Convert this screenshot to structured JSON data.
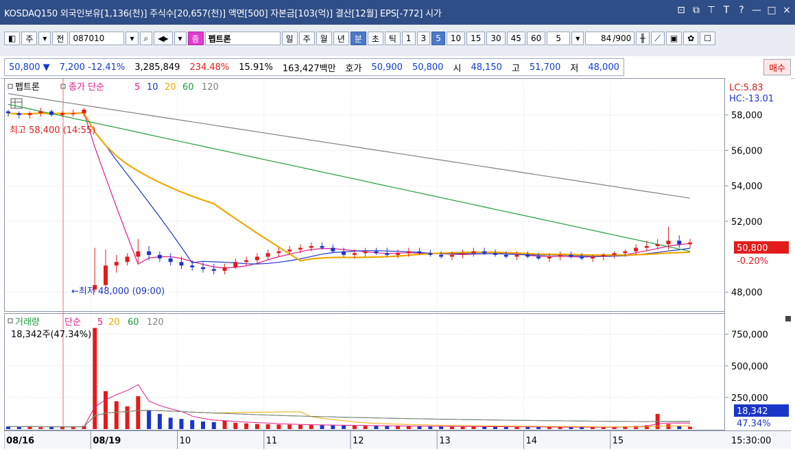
{
  "title_bar": {
    "text": "KOSDAQ150 외국인보유[1,136(천)] 주식수[20,657(천)] 액면[500] 자본금[103(억)] 결산[12월] EPS[-772] 시가"
  },
  "toolbar": {
    "mode_jusik": "주",
    "mode_jeon": "전",
    "code": "087010",
    "stock_badge": "종",
    "stock_name": "펩트론",
    "periods": [
      "일",
      "주",
      "월",
      "년",
      "분",
      "초",
      "틱"
    ],
    "minutes": [
      "1",
      "3",
      "5",
      "10",
      "15",
      "30",
      "45",
      "60"
    ],
    "active_minute": "5",
    "period_select": "5",
    "count_value": "84",
    "count_total": "/900"
  },
  "quote": {
    "price": "50,800",
    "change": "7,200",
    "change_pct": "-12.41%",
    "volume": "3,285,849",
    "vol_ratio": "234.48%",
    "turnover": "15.91%",
    "amount": "163,427백만",
    "hoga_label": "호가",
    "ask": "50,900",
    "bid": "50,800",
    "open_label": "시",
    "open": "48,150",
    "high_label": "고",
    "high": "51,700",
    "low_label": "저",
    "low": "48,000",
    "buy_btn": "매수"
  },
  "price_panel": {
    "name": "펩트론",
    "legend_prefix": "종가 단순",
    "ma_labels": [
      "5",
      "10",
      "20",
      "60",
      "120"
    ],
    "ma_colors": [
      "#e0198a",
      "#1a35c8",
      "#f0a800",
      "#1f9a3a",
      "#808080"
    ],
    "high_note": "최고 58,400 (14:55)",
    "low_note": "←최저 48,000 (09:00)",
    "lc": "LC:5.83",
    "hc": "HC:-13.01",
    "last_price": "50,800",
    "last_pct": "-0.20%",
    "y_ticks": [
      "58,000",
      "56,000",
      "54,000",
      "52,000",
      "48,000"
    ]
  },
  "volume_panel": {
    "name": "거래량",
    "legend_prefix": "단순",
    "ma_labels": [
      "5",
      "20",
      "60",
      "120"
    ],
    "ma_colors": [
      "#e0198a",
      "#f0a800",
      "#1f9a3a",
      "#808080"
    ],
    "current": "18,342주(47.34%)",
    "y_ticks": [
      "750,000",
      "500,000",
      "250,000"
    ],
    "last_vol": "18,342",
    "last_pct": "47.34%"
  },
  "x_axis": {
    "labels": [
      "08/16",
      "08/19",
      "10",
      "11",
      "12",
      "13",
      "14",
      "15"
    ],
    "time": "15:30:00"
  },
  "chart_data": {
    "type": "candlestick",
    "price_ylim": [
      47000,
      60000
    ],
    "candles": [
      [
        58200,
        58300,
        57900,
        58100
      ],
      [
        58100,
        58200,
        57800,
        58000
      ],
      [
        58000,
        58200,
        57800,
        58100
      ],
      [
        58100,
        58400,
        57900,
        58200
      ],
      [
        58200,
        58300,
        57900,
        58000
      ],
      [
        58000,
        58200,
        57900,
        58100
      ],
      [
        58100,
        58300,
        57900,
        58100
      ],
      [
        58100,
        58400,
        57900,
        58300
      ],
      [
        48150,
        50500,
        48000,
        48400
      ],
      [
        48400,
        50400,
        48200,
        49500
      ],
      [
        49500,
        50100,
        49100,
        49700
      ],
      [
        49700,
        50200,
        49500,
        50000
      ],
      [
        50000,
        51000,
        49600,
        50300
      ],
      [
        50300,
        50600,
        49800,
        50100
      ],
      [
        50100,
        50300,
        49700,
        49900
      ],
      [
        49900,
        50200,
        49500,
        49700
      ],
      [
        49700,
        50000,
        49300,
        49500
      ],
      [
        49500,
        49800,
        49200,
        49400
      ],
      [
        49400,
        49700,
        49100,
        49300
      ],
      [
        49300,
        49600,
        49000,
        49200
      ],
      [
        49200,
        49600,
        49000,
        49400
      ],
      [
        49400,
        49900,
        49300,
        49700
      ],
      [
        49700,
        50000,
        49500,
        49800
      ],
      [
        49800,
        50200,
        49600,
        50000
      ],
      [
        50000,
        50400,
        49800,
        50200
      ],
      [
        50200,
        50500,
        50000,
        50300
      ],
      [
        50300,
        50600,
        50100,
        50400
      ],
      [
        50400,
        50700,
        50200,
        50500
      ],
      [
        50500,
        50800,
        50300,
        50600
      ],
      [
        50600,
        50800,
        50400,
        50500
      ],
      [
        50500,
        50700,
        50200,
        50300
      ],
      [
        50300,
        50500,
        50000,
        50100
      ],
      [
        50100,
        50400,
        49900,
        50200
      ],
      [
        50200,
        50500,
        50000,
        50300
      ],
      [
        50300,
        50500,
        50100,
        50200
      ],
      [
        50200,
        50500,
        50000,
        50100
      ],
      [
        50100,
        50400,
        49900,
        50200
      ],
      [
        50200,
        50500,
        50000,
        50300
      ],
      [
        50300,
        50500,
        50100,
        50200
      ],
      [
        50200,
        50400,
        50000,
        50100
      ],
      [
        50100,
        50300,
        49900,
        50000
      ],
      [
        50000,
        50300,
        49800,
        50100
      ],
      [
        50100,
        50400,
        49900,
        50200
      ],
      [
        50200,
        50500,
        50000,
        50300
      ],
      [
        50300,
        50500,
        50100,
        50200
      ],
      [
        50200,
        50400,
        50000,
        50100
      ],
      [
        50100,
        50300,
        49900,
        50000
      ],
      [
        50000,
        50300,
        49800,
        50100
      ],
      [
        50100,
        50300,
        49900,
        50000
      ],
      [
        50000,
        50200,
        49800,
        49900
      ],
      [
        49900,
        50200,
        49700,
        50000
      ],
      [
        50000,
        50300,
        49800,
        50100
      ],
      [
        50100,
        50300,
        49900,
        50000
      ],
      [
        50000,
        50200,
        49800,
        49900
      ],
      [
        49900,
        50100,
        49700,
        50000
      ],
      [
        50000,
        50200,
        49800,
        50100
      ],
      [
        50100,
        50300,
        49900,
        50200
      ],
      [
        50200,
        50400,
        50000,
        50300
      ],
      [
        50300,
        50700,
        50100,
        50500
      ],
      [
        50500,
        50900,
        50300,
        50600
      ],
      [
        50600,
        51000,
        50400,
        50700
      ],
      [
        50700,
        51700,
        50400,
        50900
      ],
      [
        50900,
        51200,
        50500,
        50700
      ],
      [
        50700,
        51000,
        50500,
        50800
      ]
    ],
    "volumes": [
      20000,
      18000,
      22000,
      15000,
      17000,
      19000,
      16000,
      25000,
      800000,
      300000,
      220000,
      180000,
      260000,
      150000,
      120000,
      90000,
      80000,
      70000,
      60000,
      55000,
      65000,
      50000,
      45000,
      40000,
      38000,
      36000,
      35000,
      33000,
      32000,
      30000,
      29000,
      28000,
      27000,
      26000,
      25000,
      24000,
      23000,
      22000,
      22000,
      21000,
      20000,
      20000,
      19000,
      19000,
      18000,
      18000,
      17000,
      17000,
      16000,
      16000,
      15000,
      15000,
      15000,
      14000,
      14000,
      16000,
      18000,
      22000,
      25000,
      30000,
      120000,
      40000,
      25000,
      18342
    ],
    "vol_ylim": [
      0,
      900000
    ]
  }
}
